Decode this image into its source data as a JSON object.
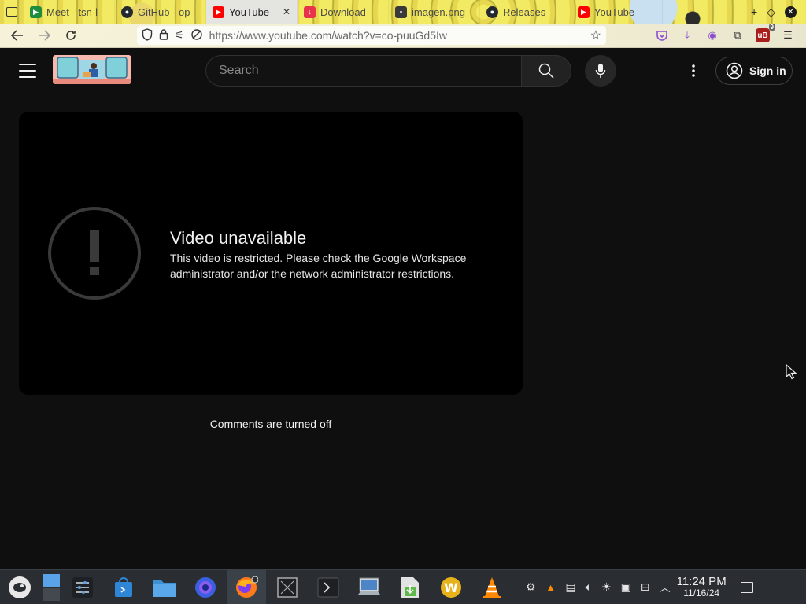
{
  "browser": {
    "tabs": [
      {
        "label": "Meet - tsn-l",
        "favicon": "google-meet-icon",
        "color": "#1e8e3e"
      },
      {
        "label": "GitHub - op",
        "favicon": "github-icon",
        "color": "#24292f"
      },
      {
        "label": "YouTube",
        "favicon": "youtube-icon",
        "color": "#ff0000",
        "active": true,
        "close": "✕"
      },
      {
        "label": "Download",
        "favicon": "download-icon",
        "color": "#e8334a"
      },
      {
        "label": "imagen.png",
        "favicon": "image-icon",
        "color": "#3a3a3a"
      },
      {
        "label": "Releases",
        "favicon": "github-icon",
        "color": "#24292f"
      },
      {
        "label": "YouTube",
        "favicon": "youtube-icon",
        "color": "#ff0000"
      }
    ],
    "new_tab": "+",
    "url": "https://www.youtube.com/watch?v=co-puuGd5Iw",
    "ublock_badge": "9"
  },
  "youtube": {
    "search_placeholder": "Search",
    "sign_in_label": "Sign in",
    "error_title": "Video unavailable",
    "error_message": "This video is restricted. Please check the Google Workspace administrator and/or the network administrator restrictions.",
    "comments_text": "Comments are turned off"
  },
  "taskbar": {
    "time": "11:24 PM",
    "date": "11/16/24"
  }
}
